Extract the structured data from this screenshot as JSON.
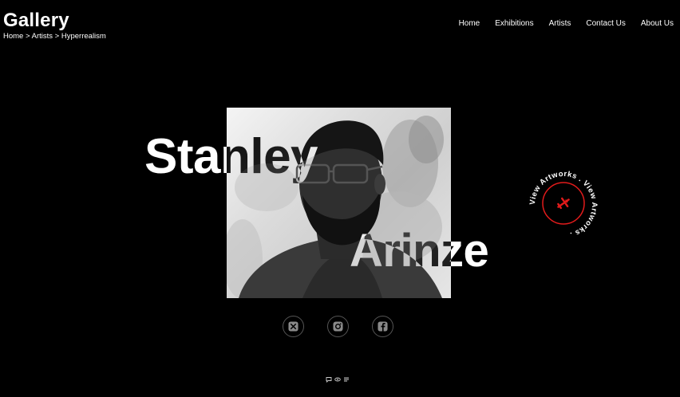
{
  "header": {
    "title": "Gallery",
    "breadcrumb": [
      {
        "label": "Home"
      },
      {
        "label": "Artists"
      },
      {
        "label": "Hyperrealism"
      }
    ],
    "separator": " > "
  },
  "nav": {
    "items": [
      {
        "label": "Home"
      },
      {
        "label": "Exhibitions"
      },
      {
        "label": "Artists"
      },
      {
        "label": "Contact Us"
      },
      {
        "label": "About Us"
      }
    ]
  },
  "artist": {
    "first_name": "Stanley",
    "last_name": "Arinze"
  },
  "cta": {
    "ring_text": "View Artworks . View Artworks . ",
    "icon": "plane-icon",
    "accent": "#e21b1b"
  },
  "socials": [
    {
      "icon": "x-twitter-icon"
    },
    {
      "icon": "instagram-icon"
    },
    {
      "icon": "facebook-icon"
    }
  ],
  "mini_tools": [
    {
      "icon": "comment-icon"
    },
    {
      "icon": "eye-icon"
    },
    {
      "icon": "list-icon"
    }
  ],
  "colors": {
    "background": "#000000",
    "text": "#ffffff",
    "accent": "#e21b1b"
  }
}
